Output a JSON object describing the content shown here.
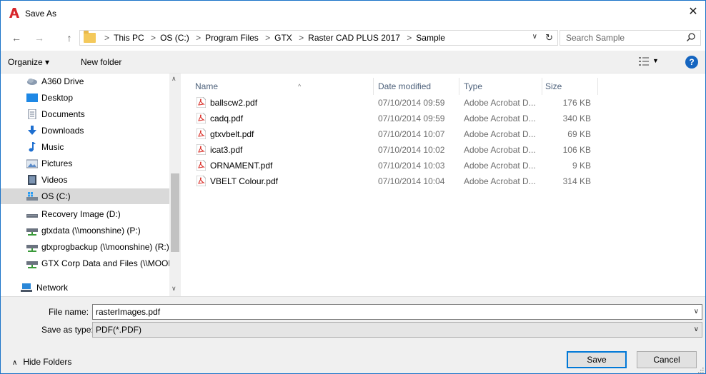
{
  "window": {
    "title": "Save As",
    "close_glyph": "✕"
  },
  "colors": {
    "accent": "#0078d7",
    "help_blue": "#1565c0",
    "app_logo_red": "#d7262b",
    "pdf_red": "#d9322b",
    "selected_bg": "#d9d9d9"
  },
  "nav": {
    "back_glyph": "←",
    "forward_glyph": "→",
    "up_glyph": "↑"
  },
  "address": {
    "crumbs": [
      "This PC",
      "OS (C:)",
      "Program Files",
      "GTX",
      "Raster CAD PLUS 2017",
      "Sample"
    ],
    "separator": ">",
    "dropdown_glyph": "∨",
    "refresh_glyph": "↻"
  },
  "search": {
    "placeholder": "Search Sample"
  },
  "toolbar": {
    "organize_label": "Organize ▾",
    "new_folder_label": "New folder",
    "view_drop_glyph": "▼",
    "help_glyph": "?"
  },
  "sidebar": {
    "items": [
      {
        "label": "A360 Drive",
        "icon": "cloud-icon"
      },
      {
        "label": "Desktop",
        "icon": "desktop-icon"
      },
      {
        "label": "Documents",
        "icon": "documents-icon"
      },
      {
        "label": "Downloads",
        "icon": "downloads-icon"
      },
      {
        "label": "Music",
        "icon": "music-icon"
      },
      {
        "label": "Pictures",
        "icon": "pictures-icon"
      },
      {
        "label": "Videos",
        "icon": "videos-icon"
      },
      {
        "label": "OS (C:)",
        "icon": "drive-icon",
        "selected": true
      },
      {
        "label": "Recovery Image (D:)",
        "icon": "drive-icon"
      },
      {
        "label": "gtxdata (\\\\moonshine) (P:)",
        "icon": "network-drive-icon"
      },
      {
        "label": "gtxprogbackup (\\\\moonshine) (R:)",
        "icon": "network-drive-icon"
      },
      {
        "label": "GTX Corp Data and Files (\\\\MOON",
        "icon": "network-drive-icon"
      },
      {
        "label": "Network",
        "icon": "network-icon"
      }
    ],
    "scroll_up_glyph": "∧",
    "scroll_down_glyph": "∨"
  },
  "filelist": {
    "columns": [
      "Name",
      "Date modified",
      "Type",
      "Size"
    ],
    "sort_glyph": "^",
    "rows": [
      {
        "name": "ballscw2.pdf",
        "date": "07/10/2014 09:59",
        "type": "Adobe Acrobat D...",
        "size": "176 KB"
      },
      {
        "name": "cadq.pdf",
        "date": "07/10/2014 09:59",
        "type": "Adobe Acrobat D...",
        "size": "340 KB"
      },
      {
        "name": "gtxvbelt.pdf",
        "date": "07/10/2014 10:07",
        "type": "Adobe Acrobat D...",
        "size": "69 KB"
      },
      {
        "name": "icat3.pdf",
        "date": "07/10/2014 10:02",
        "type": "Adobe Acrobat D...",
        "size": "106 KB"
      },
      {
        "name": "ORNAMENT.pdf",
        "date": "07/10/2014 10:03",
        "type": "Adobe Acrobat D...",
        "size": "9 KB"
      },
      {
        "name": "VBELT Colour.pdf",
        "date": "07/10/2014 10:04",
        "type": "Adobe Acrobat D...",
        "size": "314 KB"
      }
    ]
  },
  "form": {
    "file_name_label": "File name:",
    "file_name_value": "rasterImages.pdf",
    "save_type_label": "Save as type:",
    "save_type_value": "PDF(*.PDF)",
    "dropdown_glyph": "∨"
  },
  "footer": {
    "hide_folders_label": "Hide Folders",
    "hide_folders_glyph": "∧",
    "save_label": "Save",
    "cancel_label": "Cancel"
  }
}
